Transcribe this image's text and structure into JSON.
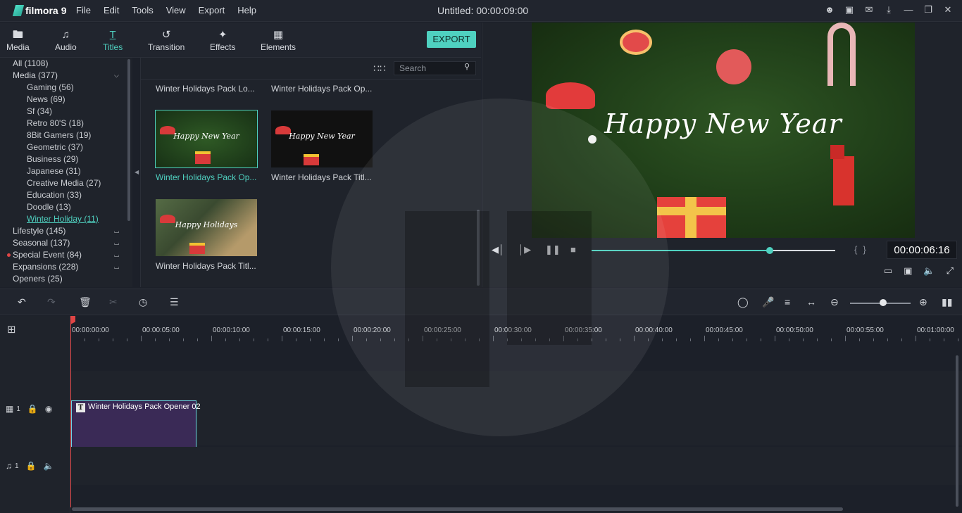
{
  "app": {
    "name": "filmora",
    "version_mark": "9",
    "menu": [
      "File",
      "Edit",
      "Tools",
      "View",
      "Export",
      "Help"
    ],
    "doc_title": "Untitled:  00:00:09:00",
    "window_icons": [
      "account-icon",
      "save-icon",
      "mail-icon",
      "download-icon",
      "minimize-icon",
      "restore-icon",
      "close-icon"
    ]
  },
  "library": {
    "tabs": [
      {
        "label": "Media",
        "icon": "folder-icon"
      },
      {
        "label": "Audio",
        "icon": "music-note-icon"
      },
      {
        "label": "Titles",
        "icon": "title-t-icon"
      },
      {
        "label": "Transition",
        "icon": "transition-icon"
      },
      {
        "label": "Effects",
        "icon": "effects-icon"
      },
      {
        "label": "Elements",
        "icon": "image-icon"
      }
    ],
    "active_tab": "Titles",
    "export_label": "EXPORT",
    "search_placeholder": "Search",
    "categories": [
      {
        "label": "All (1108)",
        "level": 0
      },
      {
        "label": "Media (377)",
        "level": 0,
        "caret": "down"
      },
      {
        "label": "Gaming (56)",
        "level": 1
      },
      {
        "label": "News (69)",
        "level": 1
      },
      {
        "label": "Sf (34)",
        "level": 1
      },
      {
        "label": "Retro 80'S (18)",
        "level": 1
      },
      {
        "label": "8Bit Gamers (19)",
        "level": 1
      },
      {
        "label": "Geometric (37)",
        "level": 1
      },
      {
        "label": "Business (29)",
        "level": 1
      },
      {
        "label": "Japanese (31)",
        "level": 1
      },
      {
        "label": "Creative Media (27)",
        "level": 1
      },
      {
        "label": "Education (33)",
        "level": 1
      },
      {
        "label": "Doodle (13)",
        "level": 1
      },
      {
        "label": "Winter Holiday (11)",
        "level": 1,
        "selected": true
      },
      {
        "label": "Lifestyle (145)",
        "level": 0,
        "caret": "up"
      },
      {
        "label": "Seasonal (137)",
        "level": 0,
        "caret": "up"
      },
      {
        "label": "Special Event (84)",
        "level": 0,
        "caret": "up",
        "dot": true
      },
      {
        "label": "Expansions (228)",
        "level": 0,
        "caret": "up"
      },
      {
        "label": "Openers (25)",
        "level": 0
      }
    ],
    "items": [
      {
        "label": "Winter Holidays Pack Lo..."
      },
      {
        "label": "Winter Holidays Pack Op..."
      },
      {
        "label": "Winter Holidays Pack Op...",
        "thumb_text": "Happy New Year",
        "selected": true
      },
      {
        "label": "Winter Holidays Pack Titl...",
        "thumb_text": "Happy New Year"
      },
      {
        "label": "Winter Holidays Pack Titl...",
        "thumb_text": "Happy Holidays"
      }
    ]
  },
  "preview": {
    "title_text": "Happy New Year",
    "timecode": "00:00:06:16",
    "progress": 0.73,
    "controls": [
      "prev-frame-icon",
      "play-icon",
      "pause-icon",
      "stop-icon"
    ],
    "tools": [
      "display-settings-icon",
      "snapshot-icon",
      "volume-icon",
      "fullscreen-icon"
    ]
  },
  "timeline": {
    "toolbar_left": [
      "undo-icon",
      "redo-icon",
      "delete-icon",
      "cut-icon",
      "duration-icon",
      "adjust-icon"
    ],
    "toolbar_right": [
      "marker-icon",
      "voiceover-icon",
      "audio-mixer-icon",
      "fit-icon",
      "zoom-out-icon",
      "zoom-in-icon",
      "layout-icon"
    ],
    "zoom_level": 0.55,
    "ruler": [
      "00:00:00:00",
      "00:00:05:00",
      "00:00:10:00",
      "00:00:15:00",
      "00:00:20:00",
      "00:00:25:00",
      "00:00:30:00",
      "00:00:35:00",
      "00:00:40:00",
      "00:00:45:00",
      "00:00:50:00",
      "00:00:55:00",
      "00:01:00:00"
    ],
    "video_track": {
      "number": "1"
    },
    "audio_track": {
      "number": "1"
    },
    "clip": {
      "label": "Winter Holidays Pack Opener 02",
      "badge": "T"
    }
  },
  "colors": {
    "accent": "#4fd1c0",
    "playhead": "#e04545",
    "clip_fill": "#3a2a56",
    "background": "#1c2029"
  }
}
